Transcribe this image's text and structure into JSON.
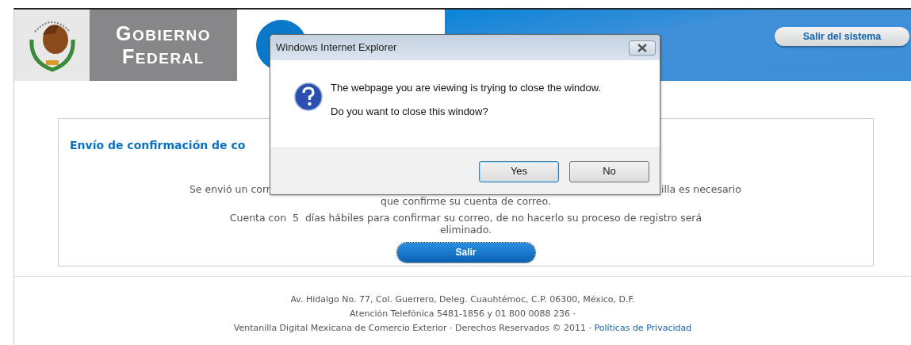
{
  "header": {
    "brand_lines": [
      "GOBIERNO",
      "FEDERAL"
    ],
    "exit_button": "Salir del sistema"
  },
  "panel": {
    "title": "Envío de confirmación de co",
    "lines": [
      {
        "parts": [
          "Se envió un corr",
          "illa es necesario"
        ]
      },
      {
        "parts": [
          "que confirme su cuenta de correo."
        ]
      },
      {
        "parts": [
          "Cuenta con  5  días hábiles para confirmar su correo, de no hacerlo su proceso de registro será"
        ]
      },
      {
        "parts": [
          "eliminado."
        ]
      }
    ],
    "button": {
      "label": "Salir",
      "focused": true
    }
  },
  "footer": {
    "lines": [
      "Av. Hidalgo No. 77, Col. Guerrero, Deleg. Cuauhtémoc, C.P. 06300, México, D.F.",
      "Atención Telefónica 5481-1856 y 01 800 0088 236 ·",
      "Ventanilla Digital Mexicana de Comercio Exterior · Derechos Reservados © 2011 ·"
    ],
    "link": "Políticas de Privacidad"
  },
  "dialog": {
    "title": "Windows Internet Explorer",
    "messages": [
      "The webpage you are viewing is trying to close the window.",
      "Do you want to close this window?"
    ],
    "buttons": [
      {
        "label": "Yes",
        "default": true
      },
      {
        "label": "No",
        "default": false
      }
    ]
  }
}
